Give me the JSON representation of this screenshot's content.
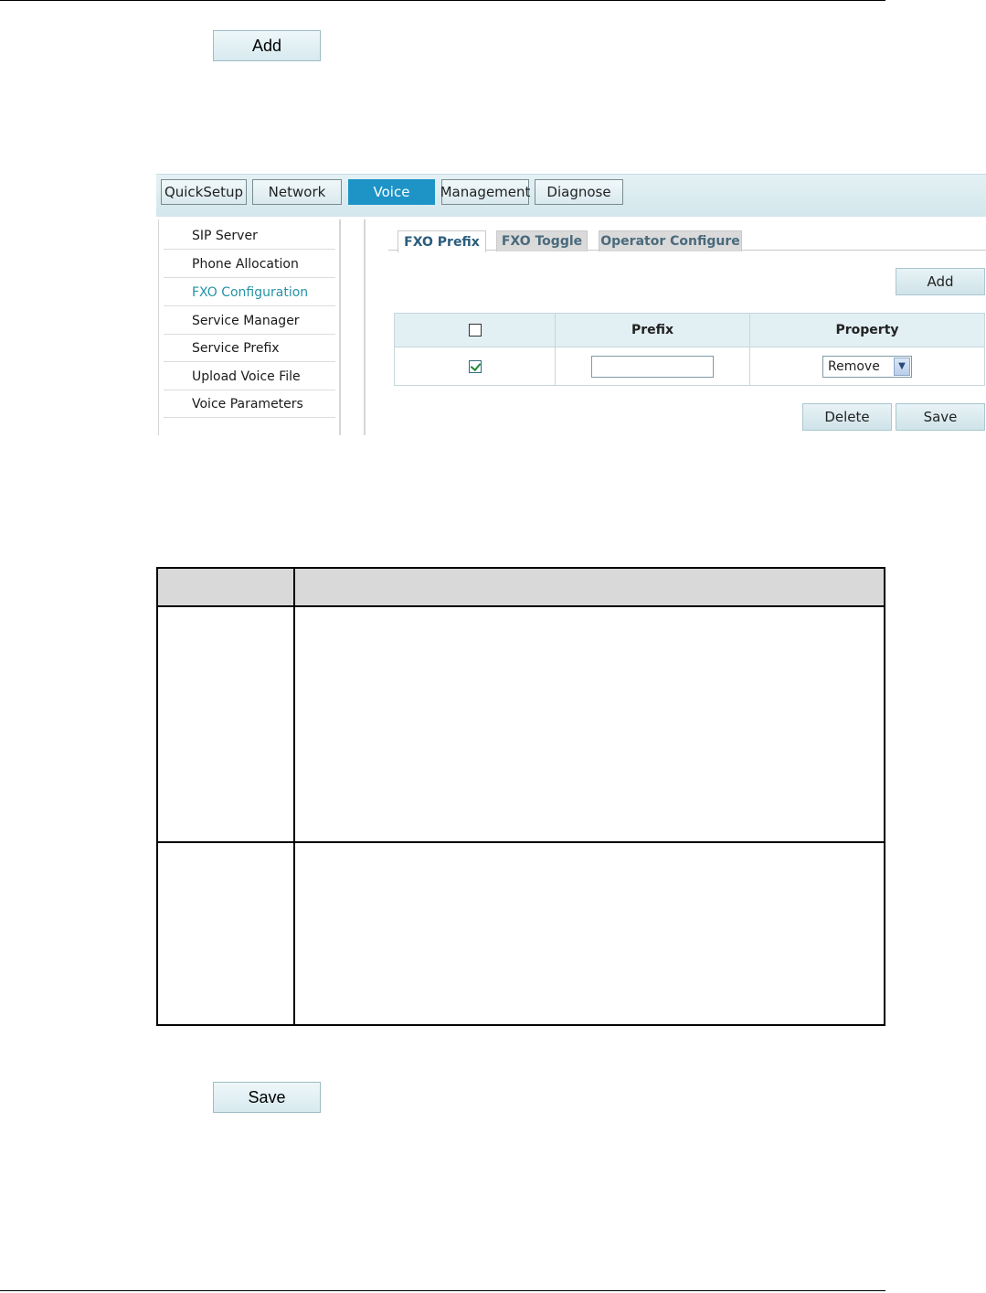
{
  "doc": {
    "add_button": "Add",
    "save_button": "Save"
  },
  "topnav": [
    "QuickSetup",
    "Network",
    "Voice",
    "Management",
    "Diagnose"
  ],
  "sidebar": [
    "SIP Server",
    "Phone Allocation",
    "FXO Configuration",
    "Service Manager",
    "Service Prefix",
    "Upload Voice File",
    "Voice Parameters"
  ],
  "tabs": [
    "FXO Prefix",
    "FXO Toggle",
    "Operator Configure"
  ],
  "panel": {
    "add_button": "Add",
    "delete_button": "Delete",
    "save_button": "Save",
    "columns": [
      "",
      "Prefix",
      "Property"
    ],
    "row": {
      "checked": true,
      "prefix": "",
      "property": "Remove"
    }
  },
  "colors": {
    "active_nav": "#1e93c6",
    "active_sidebar": "#2493a6",
    "button_bg": "#d7eaef"
  }
}
